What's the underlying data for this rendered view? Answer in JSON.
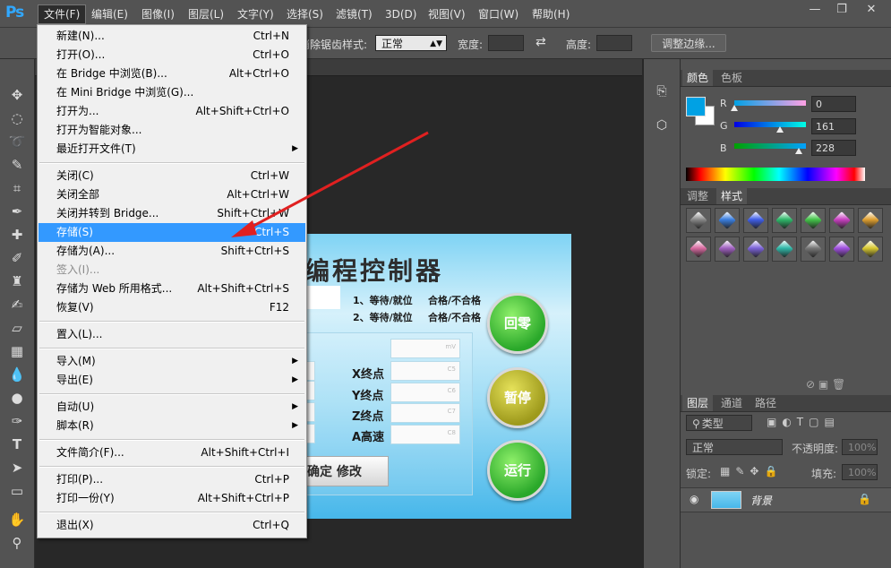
{
  "app": {
    "logo": "Ps"
  },
  "menubar": {
    "items": [
      "文件(F)",
      "编辑(E)",
      "图像(I)",
      "图层(L)",
      "文字(Y)",
      "选择(S)",
      "滤镜(T)",
      "3D(D)",
      "视图(V)",
      "窗口(W)",
      "帮助(H)"
    ],
    "active_index": 0
  },
  "window_controls": {
    "minimize": "—",
    "restore": "❐",
    "close": "✕"
  },
  "options_bar": {
    "partial_label": "消除锯齿",
    "style_label": "样式:",
    "style_value": "正常",
    "width_label": "宽度:",
    "height_label": "高度:",
    "refine_edge": "调整边缘..."
  },
  "file_menu": {
    "items": [
      {
        "label": "新建(N)...",
        "shortcut": "Ctrl+N"
      },
      {
        "label": "打开(O)...",
        "shortcut": "Ctrl+O"
      },
      {
        "label": "在 Bridge 中浏览(B)...",
        "shortcut": "Alt+Ctrl+O"
      },
      {
        "label": "在 Mini Bridge 中浏览(G)...",
        "shortcut": ""
      },
      {
        "label": "打开为...",
        "shortcut": "Alt+Shift+Ctrl+O"
      },
      {
        "label": "打开为智能对象...",
        "shortcut": ""
      },
      {
        "label": "最近打开文件(T)",
        "shortcut": "",
        "submenu": true
      },
      {
        "separator": true
      },
      {
        "label": "关闭(C)",
        "shortcut": "Ctrl+W"
      },
      {
        "label": "关闭全部",
        "shortcut": "Alt+Ctrl+W"
      },
      {
        "label": "关闭并转到 Bridge...",
        "shortcut": "Shift+Ctrl+W"
      },
      {
        "label": "存储(S)",
        "shortcut": "Ctrl+S",
        "highlighted": true
      },
      {
        "label": "存储为(A)...",
        "shortcut": "Shift+Ctrl+S"
      },
      {
        "label": "签入(I)...",
        "shortcut": "",
        "disabled": true
      },
      {
        "label": "存储为 Web 所用格式...",
        "shortcut": "Alt+Shift+Ctrl+S"
      },
      {
        "label": "恢复(V)",
        "shortcut": "F12"
      },
      {
        "separator": true
      },
      {
        "label": "置入(L)...",
        "shortcut": ""
      },
      {
        "separator": true
      },
      {
        "label": "导入(M)",
        "shortcut": "",
        "submenu": true
      },
      {
        "label": "导出(E)",
        "shortcut": "",
        "submenu": true
      },
      {
        "separator": true
      },
      {
        "label": "自动(U)",
        "shortcut": "",
        "submenu": true
      },
      {
        "label": "脚本(R)",
        "shortcut": "",
        "submenu": true
      },
      {
        "separator": true
      },
      {
        "label": "文件简介(F)...",
        "shortcut": "Alt+Shift+Ctrl+I"
      },
      {
        "separator": true
      },
      {
        "label": "打印(P)...",
        "shortcut": "Ctrl+P"
      },
      {
        "label": "打印一份(Y)",
        "shortcut": "Alt+Shift+Ctrl+P"
      },
      {
        "separator": true
      },
      {
        "label": "退出(X)",
        "shortcut": "Ctrl+Q"
      }
    ]
  },
  "document": {
    "title": "编程控制器",
    "status_lines": [
      "1、等待/就位",
      "合格/不合格",
      "2、等待/就位",
      "合格/不合格"
    ],
    "fields": [
      {
        "label": "",
        "hint": "mV"
      },
      {
        "label": "X终点",
        "hint": "C5"
      },
      {
        "label": "Y终点",
        "hint": "C6"
      },
      {
        "label": "Z终点",
        "hint": "C7"
      },
      {
        "label": "A高速",
        "hint": "C8"
      }
    ],
    "buttons": {
      "home": "回零",
      "pause": "暂停",
      "run": "运行",
      "confirm": "确定 修改"
    }
  },
  "color_panel": {
    "tabs": [
      "颜色",
      "色板"
    ],
    "r_label": "R",
    "g_label": "G",
    "b_label": "B",
    "r": "0",
    "g": "161",
    "b": "228",
    "foreground": "#00a1e4"
  },
  "styles_panel": {
    "tabs": [
      "调整",
      "样式"
    ],
    "swatches": [
      "#888888",
      "#3a7fe0",
      "#3f5ee8",
      "#2fb86a",
      "#44c44a",
      "#c840c0",
      "#e0a030",
      "#d86aa0",
      "#a060c0",
      "#7b62d8",
      "#2fb8a8",
      "#777777",
      "#a050e0",
      "#d8c830"
    ]
  },
  "layers_panel": {
    "tabs": [
      "图层",
      "通道",
      "路径"
    ],
    "kind_label": "类型",
    "blend_mode": "正常",
    "opacity_label": "不透明度:",
    "opacity_value": "100%",
    "lock_label": "锁定:",
    "fill_label": "填充:",
    "fill_value": "100%",
    "layer_name": "背景"
  }
}
